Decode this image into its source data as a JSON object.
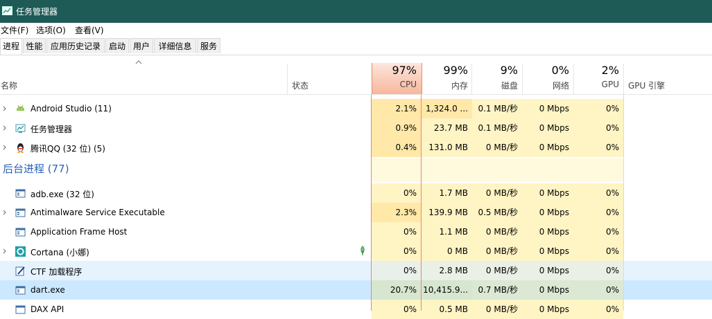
{
  "window": {
    "title": "任务管理器"
  },
  "menu": [
    "文件(F)",
    "选项(O)",
    "查看(V)"
  ],
  "tabs": [
    "进程",
    "性能",
    "应用历史记录",
    "启动",
    "用户",
    "详细信息",
    "服务"
  ],
  "columns": {
    "name": "名称",
    "status": "状态",
    "cpu": {
      "pct": "97%",
      "label": "CPU"
    },
    "memory": {
      "pct": "99%",
      "label": "内存"
    },
    "disk": {
      "pct": "9%",
      "label": "磁盘"
    },
    "network": {
      "pct": "0%",
      "label": "网络"
    },
    "gpu": {
      "pct": "2%",
      "label": "GPU"
    },
    "gpu_engine": "GPU 引擎"
  },
  "apps": [
    {
      "name": "Android Studio (11)",
      "icon": "android-icon",
      "cpu": "2.1%",
      "mem": "1,324.0 ...",
      "disk": "0.1 MB/秒",
      "net": "0 Mbps",
      "gpu": "0%"
    },
    {
      "name": "任务管理器",
      "icon": "task-manager-icon",
      "cpu": "0.9%",
      "mem": "23.7 MB",
      "disk": "0.1 MB/秒",
      "net": "0 Mbps",
      "gpu": "0%"
    },
    {
      "name": "腾讯QQ (32 位) (5)",
      "icon": "qq-penguin-icon",
      "cpu": "0.4%",
      "mem": "131.0 MB",
      "disk": "0 MB/秒",
      "net": "0 Mbps",
      "gpu": "0%"
    }
  ],
  "background_group": {
    "label": "后台进程 (77)"
  },
  "background": [
    {
      "name": "adb.exe (32 位)",
      "icon": "window-app-icon",
      "cpu": "0%",
      "mem": "1.7 MB",
      "disk": "0 MB/秒",
      "net": "0 Mbps",
      "gpu": "0%"
    },
    {
      "name": "Antimalware Service Executable",
      "icon": "window-app-icon",
      "cpu": "2.3%",
      "mem": "139.9 MB",
      "disk": "0.5 MB/秒",
      "net": "0 Mbps",
      "gpu": "0%"
    },
    {
      "name": "Application Frame Host",
      "icon": "window-app-icon",
      "cpu": "0%",
      "mem": "1.1 MB",
      "disk": "0 MB/秒",
      "net": "0 Mbps",
      "gpu": "0%"
    },
    {
      "name": "Cortana (小娜)",
      "icon": "cortana-icon",
      "cpu": "0%",
      "mem": "0 MB",
      "disk": "0 MB/秒",
      "net": "0 Mbps",
      "gpu": "0%"
    },
    {
      "name": "CTF 加载程序",
      "icon": "ctf-pen-icon",
      "cpu": "0%",
      "mem": "2.8 MB",
      "disk": "0 MB/秒",
      "net": "0 Mbps",
      "gpu": "0%"
    },
    {
      "name": "dart.exe",
      "icon": "window-app-icon",
      "cpu": "20.7%",
      "mem": "10,415.9...",
      "disk": "0.7 MB/秒",
      "net": "0 Mbps",
      "gpu": "0%"
    },
    {
      "name": "DAX API",
      "icon": "window-app-icon",
      "cpu": "0%",
      "mem": "0.5 MB",
      "disk": "0 MB/秒",
      "net": "0 Mbps",
      "gpu": "0%"
    }
  ],
  "colors": {
    "titlebar": "#1e5b56",
    "cpu_highlight": "#e8886a",
    "group_text": "#2a62b8",
    "selected_row": "#cce8ff"
  }
}
